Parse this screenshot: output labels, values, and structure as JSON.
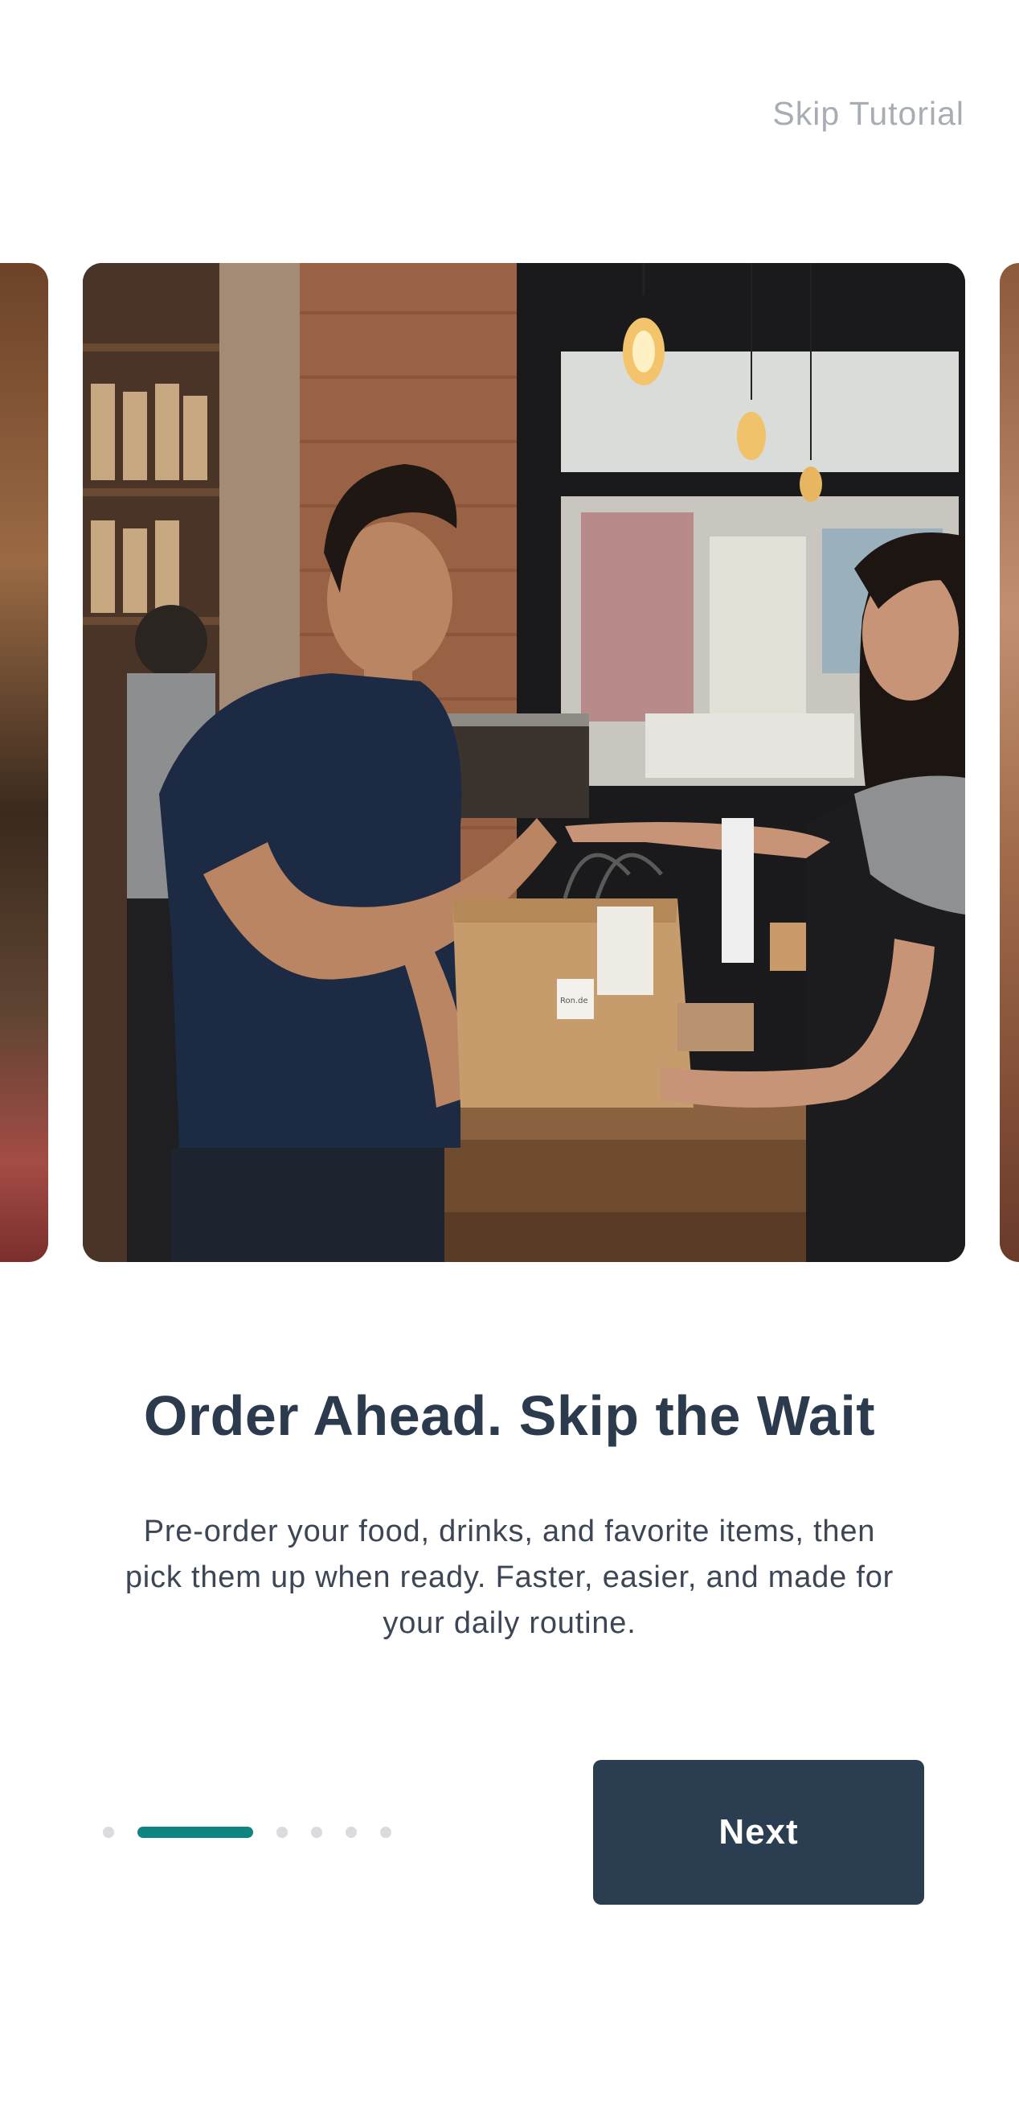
{
  "header": {
    "skip_label": "Skip Tutorial"
  },
  "carousel": {
    "active_slide_image": "cafe-barista-handing-paper-bag-photo",
    "bag_tag_text": "Ron.de"
  },
  "content": {
    "title": "Order Ahead. Skip the Wait",
    "description": "Pre-order your food, drinks, and favorite items, then pick them up when ready. Faster, easier, and made for your daily routine."
  },
  "pagination": {
    "total": 6,
    "active_index": 1
  },
  "footer": {
    "next_label": "Next"
  },
  "colors": {
    "accent": "#0f8582",
    "primary": "#2b3d50",
    "title": "#2b3a4d",
    "muted": "#a7adb5"
  }
}
